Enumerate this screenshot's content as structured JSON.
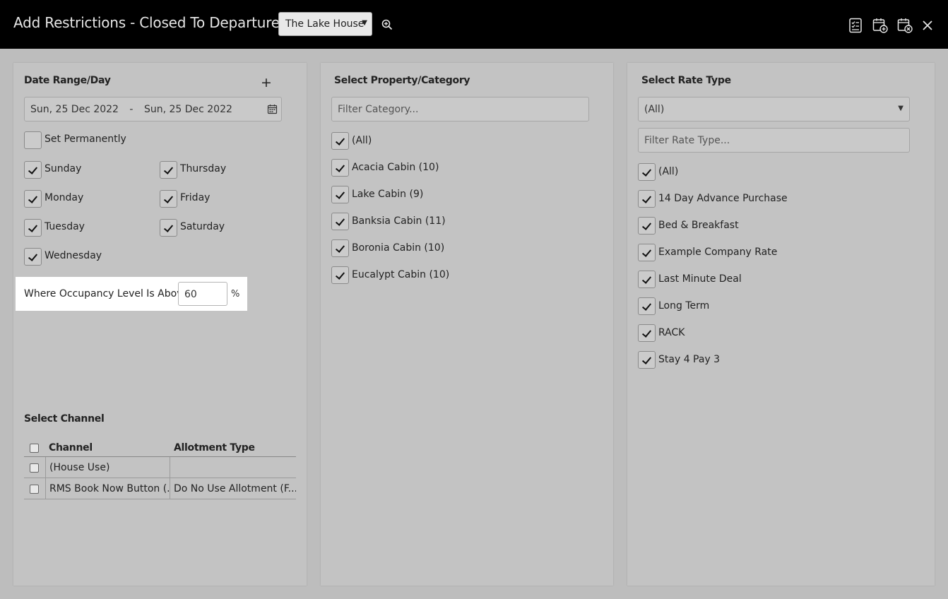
{
  "titlebar": {
    "title": "Add Restrictions - Closed To Departure",
    "property_select": "The Lake House",
    "icons": [
      "zoom-in-icon",
      "checklist-icon",
      "save-add-icon",
      "save-close-icon",
      "close-icon"
    ]
  },
  "date_panel": {
    "heading": "Date Range/Day",
    "add_label": "+",
    "date_start": "Sun, 25 Dec 2022",
    "date_sep": "-",
    "date_end": "Sun, 25 Dec 2022",
    "set_permanently": {
      "label": "Set Permanently",
      "checked": false
    },
    "days": [
      {
        "label": "Sunday",
        "checked": true
      },
      {
        "label": "Monday",
        "checked": true
      },
      {
        "label": "Tuesday",
        "checked": true
      },
      {
        "label": "Wednesday",
        "checked": true
      },
      {
        "label": "Thursday",
        "checked": true
      },
      {
        "label": "Friday",
        "checked": true
      },
      {
        "label": "Saturday",
        "checked": true
      }
    ],
    "occupancy": {
      "label": "Where Occupancy Level Is Above",
      "value": "60",
      "unit": "%"
    }
  },
  "channel": {
    "heading": "Select Channel",
    "columns": [
      "Channel",
      "Allotment Type"
    ],
    "rows": [
      {
        "channel": "(House Use)",
        "allotment": "",
        "checked": false
      },
      {
        "channel": "RMS Book Now Button (...",
        "allotment": "Do No Use Allotment (F...",
        "checked": false
      }
    ]
  },
  "category_panel": {
    "heading": "Select Property/Category",
    "filter_placeholder": "Filter Category...",
    "items": [
      {
        "label": "(All)",
        "checked": true
      },
      {
        "label": "Acacia Cabin (10)",
        "checked": true
      },
      {
        "label": "Lake Cabin (9)",
        "checked": true
      },
      {
        "label": "Banksia Cabin (11)",
        "checked": true
      },
      {
        "label": "Boronia Cabin (10)",
        "checked": true
      },
      {
        "label": "Eucalypt Cabin (10)",
        "checked": true
      }
    ]
  },
  "rate_panel": {
    "heading": "Select Rate Type",
    "select_value": "(All)",
    "filter_placeholder": "Filter Rate Type...",
    "items": [
      {
        "label": "(All)",
        "checked": true
      },
      {
        "label": "14 Day Advance Purchase",
        "checked": true
      },
      {
        "label": "Bed & Breakfast",
        "checked": true
      },
      {
        "label": "Example Company Rate",
        "checked": true
      },
      {
        "label": "Last Minute Deal",
        "checked": true
      },
      {
        "label": "Long Term",
        "checked": true
      },
      {
        "label": "RACK",
        "checked": true
      },
      {
        "label": "Stay 4 Pay 3",
        "checked": true
      }
    ]
  }
}
